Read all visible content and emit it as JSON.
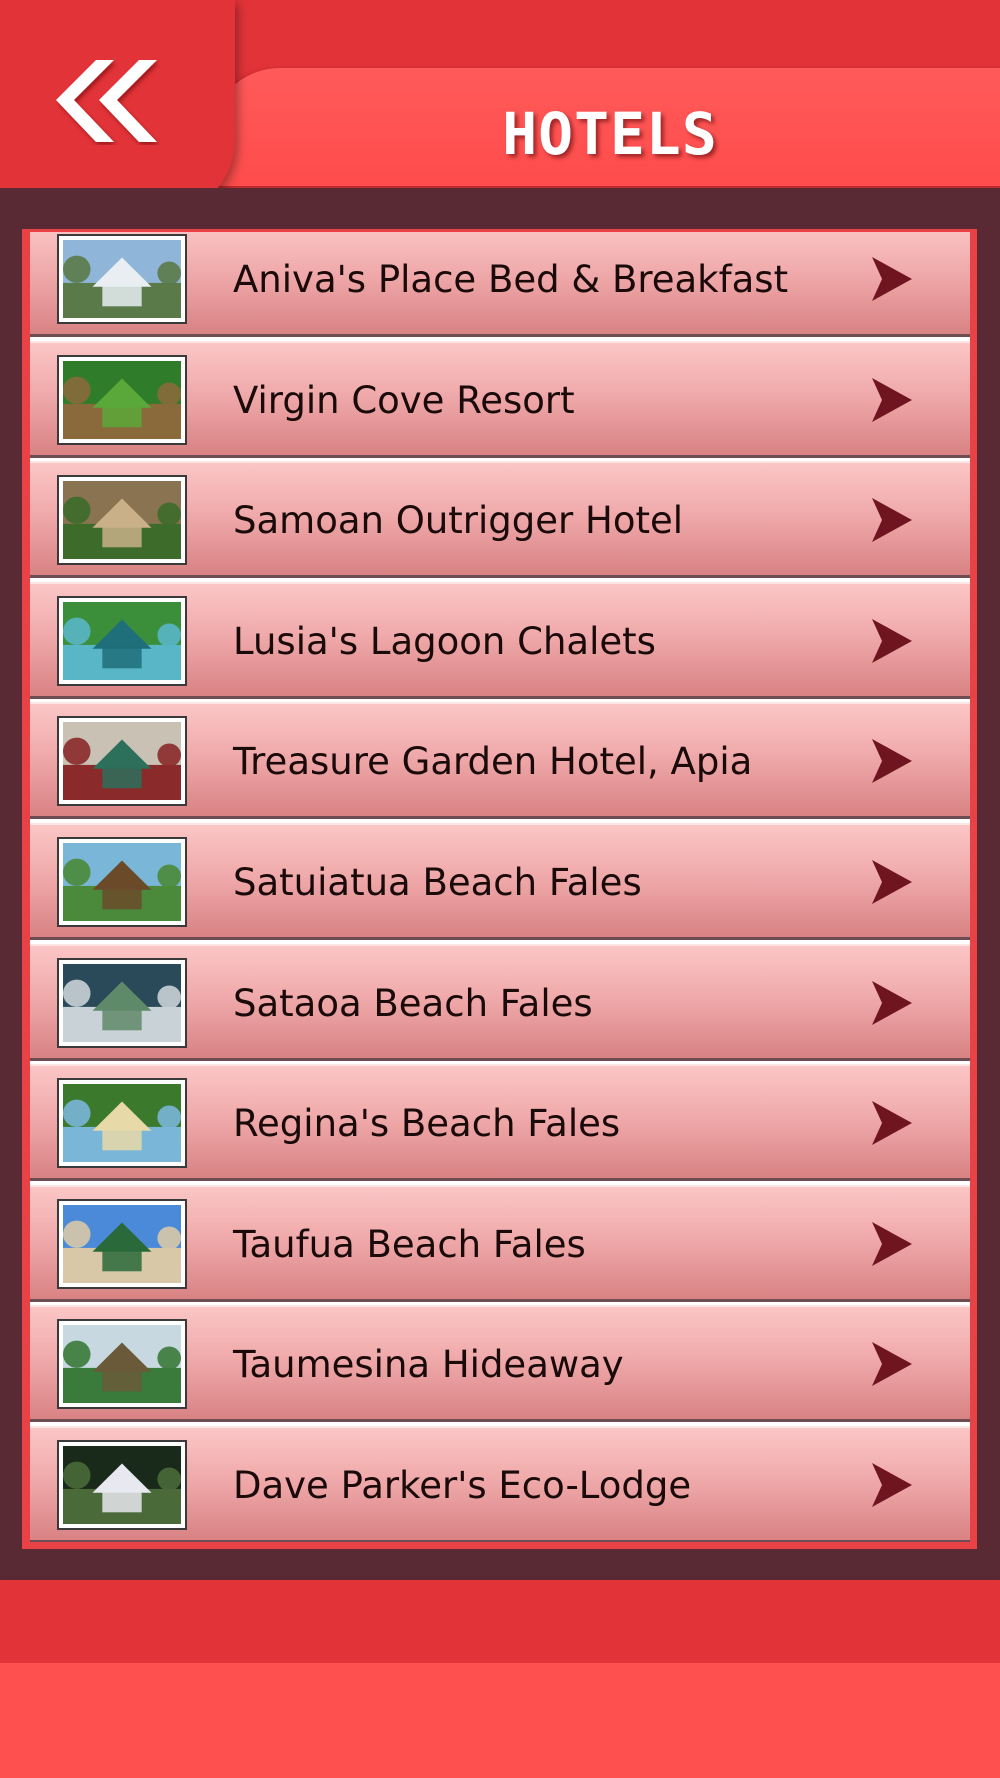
{
  "header": {
    "title": "HOTELS",
    "back_icon": "double-chevron-left-icon"
  },
  "colors": {
    "header_red": "#e23338",
    "title_bar_red": "#ff5050",
    "panel_maroon": "#5a2a34",
    "row_pink": "#f0aaab",
    "chevron_maroon": "#6e1520"
  },
  "hotels": [
    {
      "name": "Aniva's Place Bed & Breakfast",
      "thumb": "villa-photo",
      "arrow_icon": "chevron-right-icon"
    },
    {
      "name": "Virgin Cove Resort",
      "thumb": "tropical-hut-photo",
      "arrow_icon": "chevron-right-icon"
    },
    {
      "name": "Samoan Outrigger Hotel",
      "thumb": "thatched-fale-photo",
      "arrow_icon": "chevron-right-icon"
    },
    {
      "name": "Lusia's Lagoon Chalets",
      "thumb": "lagoon-chalet-photo",
      "arrow_icon": "chevron-right-icon"
    },
    {
      "name": "Treasure Garden Hotel, Apia",
      "thumb": "hotel-building-photo",
      "arrow_icon": "chevron-right-icon"
    },
    {
      "name": "Satuiatua Beach Fales",
      "thumb": "beach-fale-photo",
      "arrow_icon": "chevron-right-icon"
    },
    {
      "name": "Sataoa Beach Fales",
      "thumb": "beach-house-photo",
      "arrow_icon": "chevron-right-icon"
    },
    {
      "name": "Regina's Beach Fales",
      "thumb": "beach-shore-photo",
      "arrow_icon": "chevron-right-icon"
    },
    {
      "name": "Taufua Beach Fales",
      "thumb": "palm-beach-photo",
      "arrow_icon": "chevron-right-icon"
    },
    {
      "name": "Taumesina Hideaway",
      "thumb": "garden-pavilion-photo",
      "arrow_icon": "chevron-right-icon"
    },
    {
      "name": "Dave Parker's Eco-Lodge",
      "thumb": "eco-lodge-photo",
      "arrow_icon": "chevron-right-icon"
    }
  ]
}
